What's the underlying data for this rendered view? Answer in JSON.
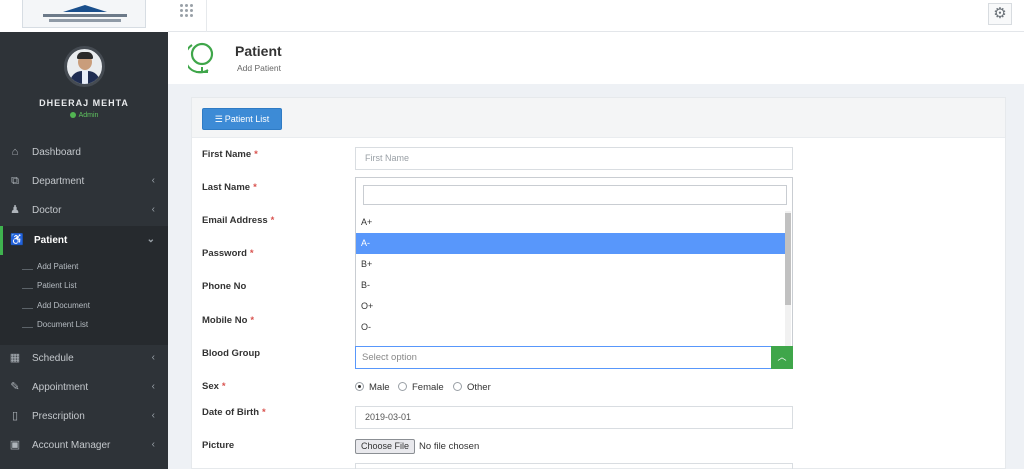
{
  "sidebar": {
    "user_name": "DHEERAJ MEHTA",
    "user_role": "Admin",
    "items": [
      {
        "label": "Dashboard",
        "icon": "home-icon",
        "has_children": false
      },
      {
        "label": "Department",
        "icon": "sitemap-icon",
        "has_children": true
      },
      {
        "label": "Doctor",
        "icon": "user-md-icon",
        "has_children": true
      },
      {
        "label": "Patient",
        "icon": "wheelchair-icon",
        "has_children": true,
        "expanded": true
      },
      {
        "label": "Schedule",
        "icon": "calendar-icon",
        "has_children": true
      },
      {
        "label": "Appointment",
        "icon": "edit-icon",
        "has_children": true
      },
      {
        "label": "Prescription",
        "icon": "book-icon",
        "has_children": true
      },
      {
        "label": "Account Manager",
        "icon": "money-icon",
        "has_children": true
      }
    ],
    "patient_submenu": [
      "Add Patient",
      "Patient List",
      "Add Document",
      "Document List"
    ]
  },
  "header": {
    "title": "Patient",
    "subtitle": "Add Patient"
  },
  "panel": {
    "list_button": "Patient List"
  },
  "form": {
    "first_name_label": "First Name",
    "first_name_placeholder": "First Name",
    "last_name_label": "Last Name",
    "email_label": "Email Address",
    "password_label": "Password",
    "phone_label": "Phone No",
    "mobile_label": "Mobile No",
    "blood_group_label": "Blood Group",
    "blood_group_placeholder": "Select option",
    "blood_group_options": [
      "A+",
      "A-",
      "B+",
      "B-",
      "O+",
      "O-"
    ],
    "blood_group_highlighted": "A-",
    "sex_label": "Sex",
    "sex_options": [
      "Male",
      "Female",
      "Other"
    ],
    "sex_selected": "Male",
    "dob_label": "Date of Birth",
    "dob_value": "2019-03-01",
    "picture_label": "Picture",
    "file_button": "Choose File",
    "file_status": "No file chosen",
    "required_mark": "*"
  },
  "colors": {
    "sidebar_bg": "#2e3338",
    "active_accent": "#3fb34f",
    "primary_button": "#3d8bd6",
    "dropdown_highlight": "#5897fb",
    "select_arrow": "#3fa64a",
    "required": "#d9534f"
  }
}
